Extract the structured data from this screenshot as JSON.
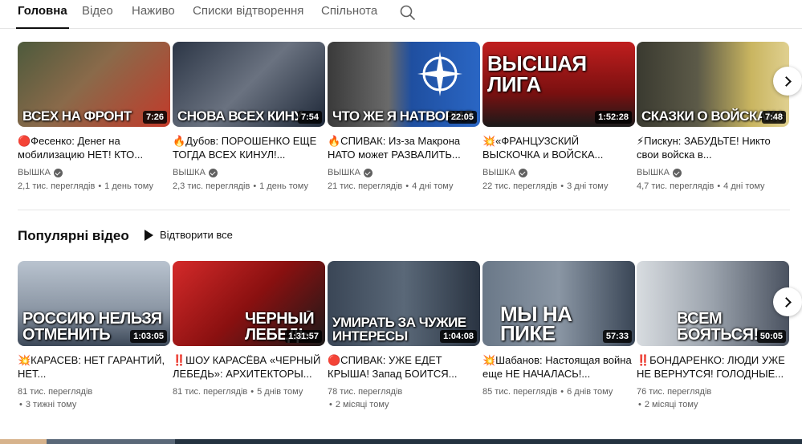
{
  "tabs": [
    {
      "label": "Головна",
      "active": true
    },
    {
      "label": "Відео"
    },
    {
      "label": "Наживо"
    },
    {
      "label": "Списки відтворення"
    },
    {
      "label": "Спільнота"
    }
  ],
  "icons": {
    "search": "search-icon",
    "next": "chevron-right-icon",
    "play": "play-icon",
    "verified": "verified-check-icon"
  },
  "row1": [
    {
      "caption": "ВСЕХ НА ФРОНТ",
      "duration": "7:26",
      "title": "🔴Фесенко: Денег на мобилизацию НЕТ! КТО...",
      "channel": "ВЫШКА",
      "views": "2,1 тис. переглядів",
      "age": "1 день тому",
      "bg": "#6b4a3a"
    },
    {
      "caption": "СНОВА ВСЕХ КИНУ",
      "duration": "7:54",
      "title": "🔥Дубов: ПОРОШЕНКО ЕЩЕ ТОГДА ВСЕХ КИНУЛ!...",
      "channel": "ВЫШКА",
      "views": "2,3 тис. переглядів",
      "age": "1 день тому",
      "bg": "#3c4658"
    },
    {
      "caption": "ЧТО ЖЕ Я НАТВОРИЛ",
      "duration": "22:05",
      "title": "🔥СПИВАК: Из-за Макрона НАТО может РАЗВАЛИТЬ...",
      "channel": "ВЫШКА",
      "views": "21 тис. переглядів",
      "age": "4 дні тому",
      "bg": "#1f4fa0"
    },
    {
      "caption": "ВЫСШАЯ ЛИГА",
      "duration": "1:52:28",
      "title": "💥«ФРАНЦУЗСКИЙ ВЫСКОЧКА и ВОЙСКА...",
      "channel": "ВЫШКА",
      "views": "22 тис. переглядів",
      "age": "3 дні тому",
      "bg": "#8a1414"
    },
    {
      "caption": "СКАЗКИ О ВОЙСКАХ Н",
      "duration": "7:48",
      "title": "⚡Пискун: ЗАБУДЬТЕ! Никто свои войска в...",
      "channel": "ВЫШКА",
      "views": "4,7 тис. переглядів",
      "age": "4 дні тому",
      "bg": "#5c5a48"
    }
  ],
  "section": {
    "title": "Популярні відео",
    "play_all": "Відтворити все"
  },
  "row2": [
    {
      "caption": "РОССИЮ НЕЛЬЗЯ ОТМЕНИТЬ",
      "duration": "1:03:05",
      "title": "💥КАРАСЕВ: НЕТ ГАРАНТИЙ, НЕТ...",
      "channel": "",
      "views": "81 тис. переглядів",
      "age": "3 тижні тому",
      "bg": "#7f8a98"
    },
    {
      "caption": "ЧЕРНЫЙ ЛЕБЕДЬ",
      "duration": "1:31:57",
      "title": "‼️ШОУ КАРАСЁВА «ЧЕРНЫЙ ЛЕБЕДЬ»: АРХИТЕКТОРЫ...",
      "channel": "",
      "views": "81 тис. переглядів",
      "age": "5 днів тому",
      "bg": "#b81b1b"
    },
    {
      "caption": "УМИРАТЬ ЗА ЧУЖИЕ ИНТЕРЕСЫ",
      "duration": "1:04:08",
      "title": "🔴СПИВАК: УЖЕ ЕДЕТ КРЫША! Запад БОИТСЯ...",
      "channel": "",
      "views": "78 тис. переглядів",
      "age": "2 місяці тому",
      "bg": "#4a5868"
    },
    {
      "caption": "МЫ НА ПИКЕ",
      "duration": "57:33",
      "title": "💥Шабанов: Настоящая война еще НЕ НАЧАЛАСЬ!...",
      "channel": "",
      "views": "85 тис. переглядів",
      "age": "6 днів тому",
      "bg": "#56657a"
    },
    {
      "caption": "ВСЕМ БОЯТЬСЯ!",
      "duration": "50:05",
      "title": "‼️БОНДАРЕНКО: ЛЮДИ УЖЕ НЕ ВЕРНУТСЯ! ГОЛОДНЫЕ...",
      "channel": "",
      "views": "76 тис. переглядів",
      "age": "2 місяці тому",
      "bg": "#6b7480"
    }
  ]
}
